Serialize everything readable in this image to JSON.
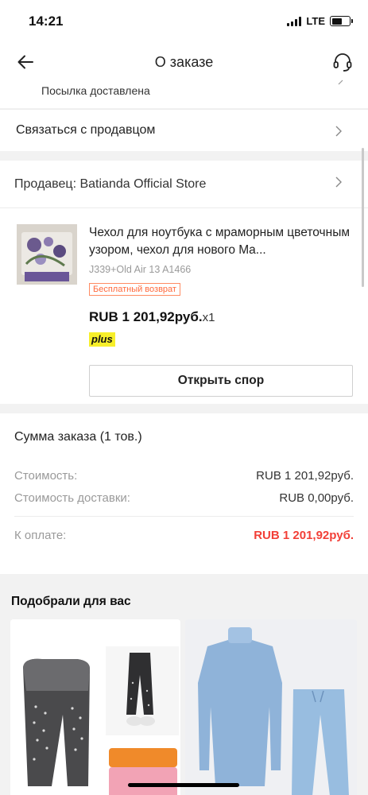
{
  "status_bar": {
    "time": "14:21",
    "network": "LTE"
  },
  "nav": {
    "title": "О заказе"
  },
  "order": {
    "delivery_status": "Посылка доставлена",
    "contact_seller": "Связаться с продавцом"
  },
  "seller": {
    "label": "Продавец: Batianda Official Store"
  },
  "product": {
    "title": "Чехол для ноутбука с мраморным цветочным узором, чехол для нового Ma...",
    "sku": "J339+Old Air 13 A1466",
    "free_return": "Бесплатный возврат",
    "price": "RUB 1 201,92руб.",
    "quantity": "x1",
    "plus_badge": "plus",
    "dispute_button": "Открыть спор"
  },
  "summary": {
    "title": "Сумма заказа (1 тов.)",
    "cost_label": "Стоимость:",
    "cost_value": "RUB 1 201,92руб.",
    "shipping_label": "Стоимость доставки:",
    "shipping_value": "RUB 0,00руб.",
    "pay_label": "К оплате:",
    "pay_value": "RUB 1 201,92руб.",
    "pay_color": "#f23f37"
  },
  "recommendations": {
    "title": "Подобрали для вас"
  }
}
